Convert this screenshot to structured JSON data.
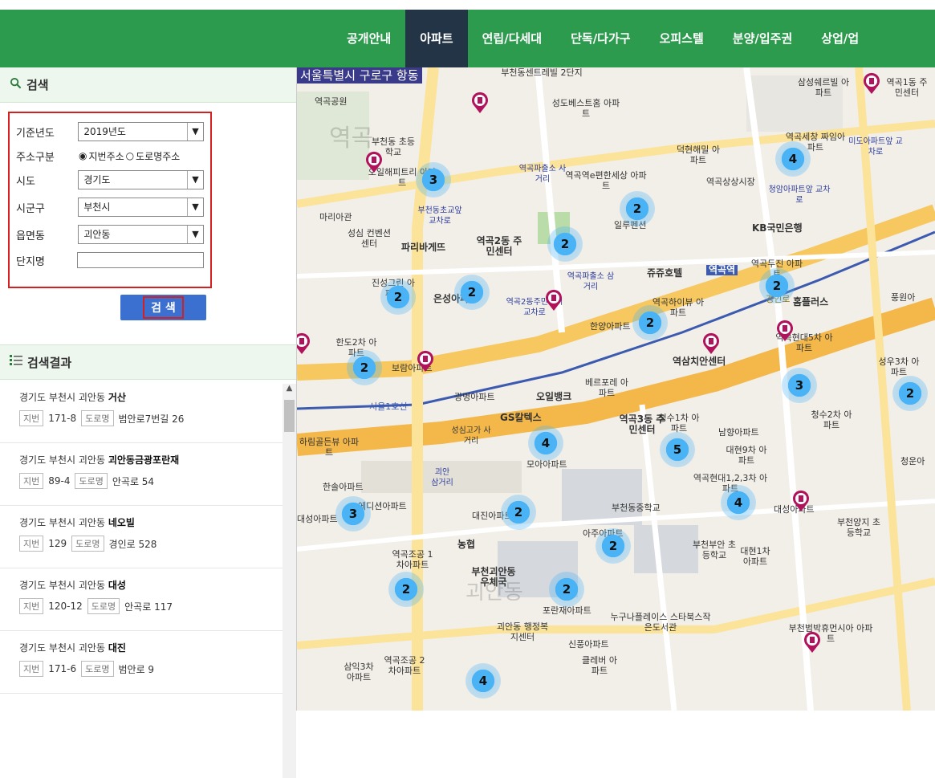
{
  "nav": {
    "items": [
      "공개안내",
      "아파트",
      "연립/다세대",
      "단독/다가구",
      "오피스텔",
      "분양/입주권",
      "상업/업"
    ],
    "active_index": 1
  },
  "search": {
    "title": "검색",
    "fields": {
      "year_label": "기준년도",
      "year_value": "2019년도",
      "addr_type_label": "주소구분",
      "addr_type_option1": "지번주소",
      "addr_type_option2": "도로명주소",
      "sido_label": "시도",
      "sido_value": "경기도",
      "sigungu_label": "시군구",
      "sigungu_value": "부천시",
      "dong_label": "읍면동",
      "dong_value": "괴안동",
      "complex_label": "단지명",
      "complex_value": ""
    },
    "button_label": "검 색"
  },
  "results": {
    "title": "검색결과",
    "jibun_tag": "지번",
    "road_tag": "도로명",
    "items": [
      {
        "prefix": "경기도 부천시 괴안동",
        "name": "거산",
        "jibun": "171-8",
        "road": "범안로7번길 26"
      },
      {
        "prefix": "경기도 부천시 괴안동",
        "name": "괴안동금광포란재",
        "jibun": "89-4",
        "road": "안곡로 54"
      },
      {
        "prefix": "경기도 부천시 괴안동",
        "name": "네오빌",
        "jibun": "129",
        "road": "경인로 528"
      },
      {
        "prefix": "경기도 부천시 괴안동",
        "name": "대성",
        "jibun": "120-12",
        "road": "안곡로 117"
      },
      {
        "prefix": "경기도 부천시 괴안동",
        "name": "대진",
        "jibun": "171-6",
        "road": "범안로 9"
      }
    ]
  },
  "map": {
    "title": "서울특별시 구로구 항동",
    "clusters": [
      "3",
      "2",
      "4",
      "2",
      "2",
      "2",
      "2",
      "2",
      "3",
      "2",
      "4",
      "5",
      "4",
      "3",
      "2",
      "2",
      "2",
      "2",
      "4",
      "2"
    ],
    "labels": {
      "l1": "역곡공원",
      "l2": "부천동센트레빌 2단지",
      "l3": "성도베스트홈 아파트",
      "l4": "삼성쉐르빌 아파트",
      "l5": "역곡1동 주민센터",
      "l6": "부천동 초등학교",
      "l7": "오일해피트리 아파트",
      "l8": "덕현해밀 아파트",
      "l9": "역곡세창 짜임아파트",
      "l10": "역곡역e편한세상 아파트",
      "l11": "역곡상상시장",
      "l12": "마리아관",
      "l13": "성심 컨벤션센터",
      "l14": "파리바게뜨",
      "l15": "역곡2동 주민센터",
      "l16": "일루펜션",
      "l17": "KB국민은행",
      "l18": "쥬쥬호텔",
      "l19": "역곡역",
      "l20": "역곡두진 아파트",
      "l21": "홈플러스",
      "l22": "풍원아",
      "l23": "진성그린 아파트",
      "l24": "은성아파트",
      "l25": "역곡하이뷰 아파트",
      "l26": "한양아파트",
      "l27": "역삼치안센터",
      "l28": "역곡현대5차 아파트",
      "l29": "성우3차 아파트",
      "l30": "한도2차 아파트",
      "l31": "보람아파트",
      "l32": "광명아파트",
      "l33": "오일뱅크",
      "l34": "베르포레 아파트",
      "l35": "GS칼텍스",
      "l36": "역곡3동 주민센터",
      "l37": "청수1차 아파트",
      "l38": "남향아파트",
      "l39": "청수2차 아파트",
      "l40": "하림골든뷰 아파트",
      "l41": "성심고가 사거리",
      "l42": "모아아파트",
      "l43": "대현9차 아파트",
      "l44": "역곡현대1,2,3차 아파트",
      "l45": "한솔아파트",
      "l46": "에디션아파트",
      "l47": "대성아파트",
      "l48": "대진아파트",
      "l49": "부천동중학교",
      "l50": "부천양지 초등학교",
      "l51": "아주아파트",
      "l52": "역곡조공 1차아파트",
      "l53": "농협",
      "l54": "부천괴안동 우체국",
      "l55": "부천부안 초등학교",
      "l56": "대현1차 아파트",
      "l57": "포란재아파트",
      "l58": "누구나플레이스 스타북스작은도서관",
      "l59": "괴안동 행정복지센터",
      "l60": "신풍아파트",
      "l61": "클레버 아파트",
      "l62": "삼익3차 아파트",
      "l63": "역곡조공 2차아파트",
      "l64": "부천범박휴먼시아 아파트",
      "l65": "서울1호선",
      "l66": "경인로",
      "l67": "역곡파출소 사거리",
      "l68": "역곡파출소 삼거리",
      "l69": "부천동초교앞 교차로",
      "l70": "미도아파트앞 교차로",
      "l71": "청암아파트앞 교차로",
      "l72": "역곡2동주민센터 교차로",
      "l73": "괴안 삼거리",
      "l74": "괴안동",
      "l75": "역곡",
      "l76": "청운아",
      "l77": "대성아파트"
    }
  }
}
